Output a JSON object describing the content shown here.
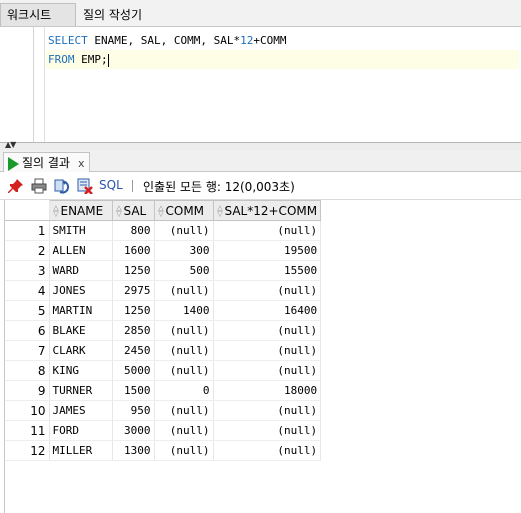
{
  "top_tabs": [
    {
      "label": "워크시트",
      "active": true
    },
    {
      "label": "질의 작성기",
      "active": false
    }
  ],
  "editor": {
    "line1": {
      "kw": "SELECT",
      "rest_a": " ENAME, SAL, COMM, SAL*",
      "num": "12",
      "rest_b": "+COMM"
    },
    "line2": {
      "kw": "FROM",
      "rest": " EMP;"
    }
  },
  "results": {
    "tab_label": "질의 결과",
    "tab_close": "x",
    "sql_label": "SQL",
    "status": "인출된 모든 행: 12(0,003초)"
  },
  "icons": {
    "pin": "pin-icon",
    "print": "print-icon",
    "refresh": "refresh-icon",
    "delete": "delete-icon",
    "run": "play-icon"
  },
  "grid": {
    "columns": [
      "ENAME",
      "SAL",
      "COMM",
      "SAL*12+COMM"
    ],
    "rows": [
      [
        "1",
        "SMITH",
        "800",
        "(null)",
        "(null)"
      ],
      [
        "2",
        "ALLEN",
        "1600",
        "300",
        "19500"
      ],
      [
        "3",
        "WARD",
        "1250",
        "500",
        "15500"
      ],
      [
        "4",
        "JONES",
        "2975",
        "(null)",
        "(null)"
      ],
      [
        "5",
        "MARTIN",
        "1250",
        "1400",
        "16400"
      ],
      [
        "6",
        "BLAKE",
        "2850",
        "(null)",
        "(null)"
      ],
      [
        "7",
        "CLARK",
        "2450",
        "(null)",
        "(null)"
      ],
      [
        "8",
        "KING",
        "5000",
        "(null)",
        "(null)"
      ],
      [
        "9",
        "TURNER",
        "1500",
        "0",
        "18000"
      ],
      [
        "10",
        "JAMES",
        "950",
        "(null)",
        "(null)"
      ],
      [
        "11",
        "FORD",
        "3000",
        "(null)",
        "(null)"
      ],
      [
        "12",
        "MILLER",
        "1300",
        "(null)",
        "(null)"
      ]
    ]
  }
}
